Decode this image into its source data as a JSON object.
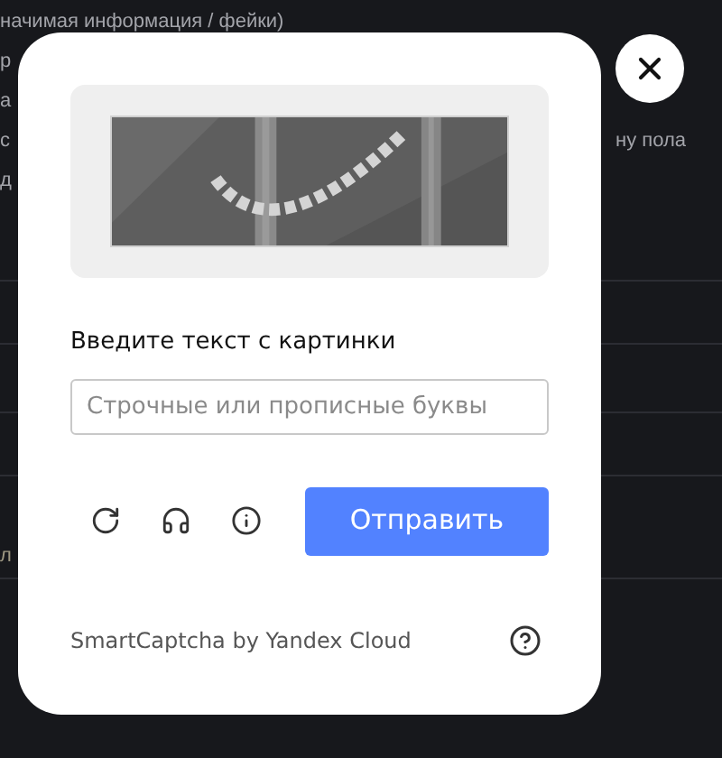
{
  "background": {
    "lines": [
      {
        "left": "начимая информация / фейки)"
      },
      {
        "left": "р"
      },
      {
        "left": "а"
      },
      {
        "left": "с",
        "right": "ну пола"
      },
      {
        "left": "д"
      }
    ],
    "fragment": "л"
  },
  "captcha": {
    "prompt": "Введите текст с картинки",
    "input": {
      "placeholder": "Строчные или прописные буквы"
    },
    "submit": "Отправить",
    "footer": "SmartCaptcha by Yandex Cloud"
  }
}
